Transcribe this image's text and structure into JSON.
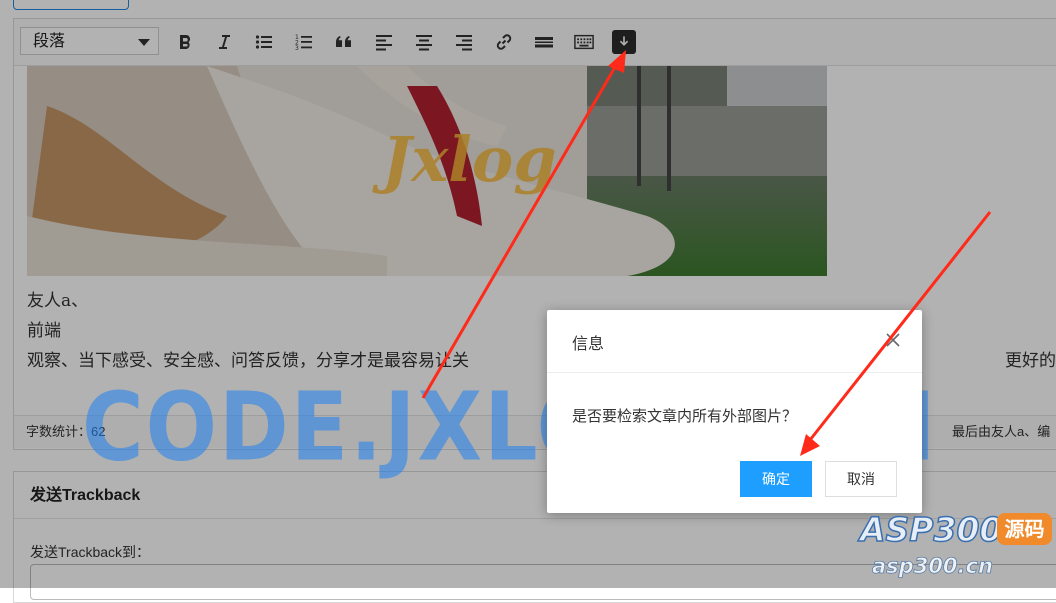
{
  "toolbar": {
    "paragraph_select": "段落",
    "buttons": [
      "bold-icon",
      "italic-icon",
      "bulleted-list-icon",
      "numbered-list-icon",
      "quote-icon",
      "align-left-icon",
      "align-center-icon",
      "align-right-icon",
      "link-icon",
      "horizontal-rule-icon",
      "keyboard-icon",
      "download-images-icon"
    ]
  },
  "photo": {
    "watermark_text": "Jxlog"
  },
  "content": {
    "lines": [
      "友人a、",
      "前端",
      "观察、当下感受、安全感、问答反馈，分享才是最容易让关",
      "更好的自己。"
    ]
  },
  "statusbar": {
    "word_count": "字数统计：62",
    "last_edited": "最后由友人a、编"
  },
  "trackback": {
    "title": "发送Trackback",
    "label": "发送Trackback到："
  },
  "dialog": {
    "title": "信息",
    "message": "是否要检索文章内所有外部图片？",
    "ok_label": "确定",
    "cancel_label": "取消"
  },
  "watermark": "CODE.JXLOG.COM",
  "brand": {
    "name": "ASP300",
    "badge": "源码",
    "url": "asp300.cn"
  },
  "colors": {
    "primary_button": "#1e9fff",
    "annotation_arrow": "#ff2a1a",
    "watermark": "#1e82f0"
  }
}
